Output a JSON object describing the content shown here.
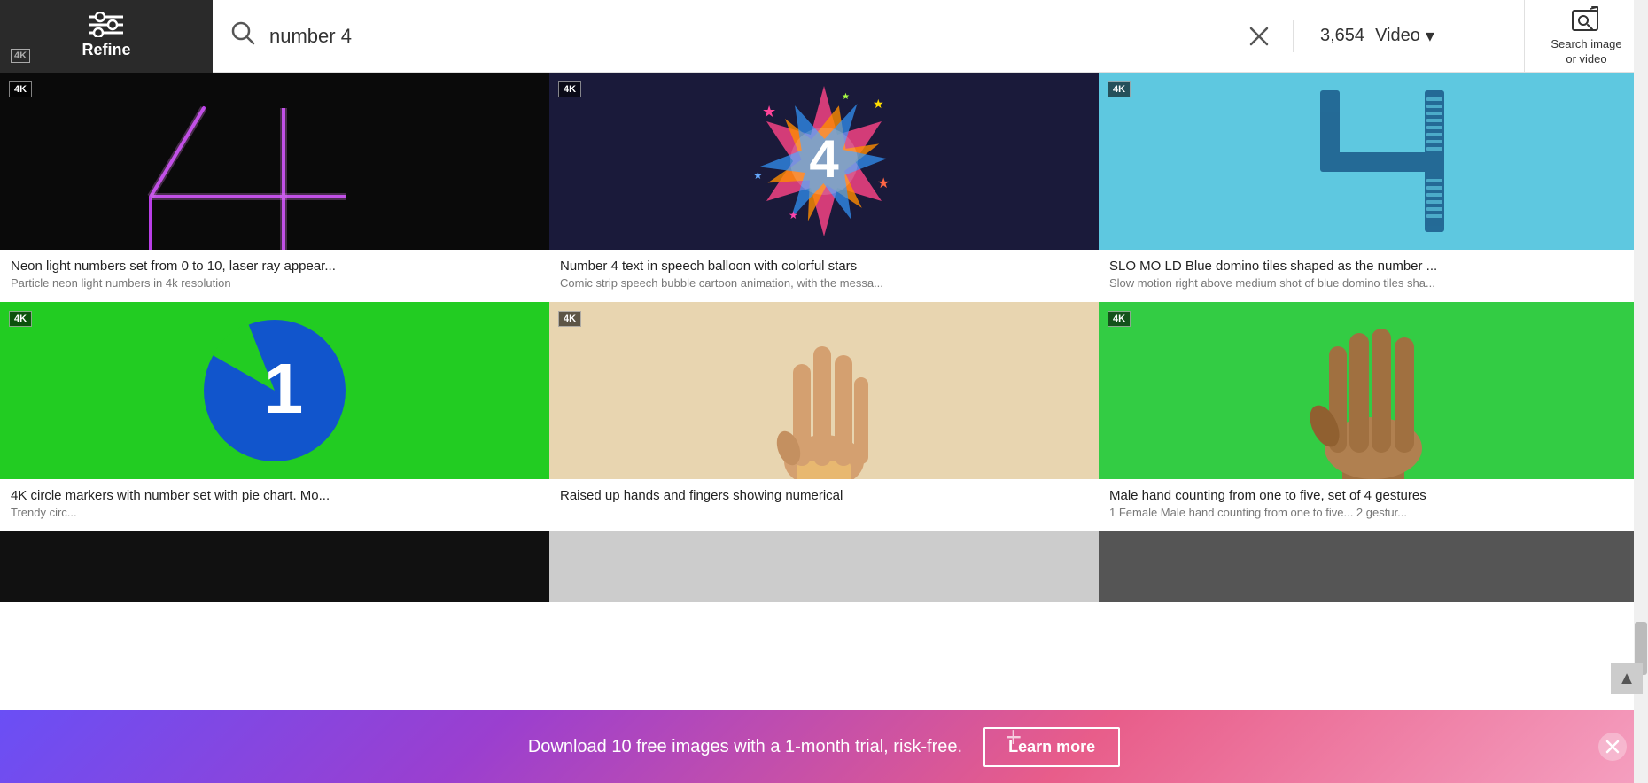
{
  "header": {
    "refine_label": "Refine",
    "refine_4k": "4K",
    "search_query": "number 4",
    "results_count": "3,654",
    "video_label": "Video",
    "search_image_label": "Search image\nor video"
  },
  "grid": {
    "items": [
      {
        "id": 1,
        "badge": "4K",
        "title": "Neon light numbers set from 0 to 10, laser ray appear...",
        "subtitle": "Particle neon light numbers in 4k resolution",
        "thumb_class": "thumb-1",
        "row": 0
      },
      {
        "id": 2,
        "badge": "4K",
        "title": "Number 4 text in speech balloon with colorful stars",
        "subtitle": "Comic strip speech bubble cartoon animation, with the messa...",
        "thumb_class": "thumb-2",
        "row": 0
      },
      {
        "id": 3,
        "badge": "4K",
        "title": "SLO MO LD Blue domino tiles shaped as the number ...",
        "subtitle": "Slow motion right above medium shot of blue domino tiles sha...",
        "thumb_class": "thumb-3",
        "row": 0
      },
      {
        "id": 4,
        "badge": "4K",
        "title": "4K circle markers with number set with pie chart. Mo...",
        "subtitle": "Trendy circ...",
        "thumb_class": "thumb-4",
        "row": 1
      },
      {
        "id": 5,
        "badge": "4K",
        "title": "Raised up hands and fingers showing numerical",
        "subtitle": "",
        "thumb_class": "thumb-5",
        "row": 1
      },
      {
        "id": 6,
        "badge": "4K",
        "title": "Male hand counting from one to five, set of 4 gestures",
        "subtitle": "1 Female Male hand counting from one to five... 2 gestur...",
        "thumb_class": "thumb-6",
        "row": 1
      }
    ]
  },
  "banner": {
    "text": "Download 10 free images with a 1-month trial, risk-free.",
    "learn_more": "Learn more",
    "plus_symbol": "+"
  },
  "icons": {
    "search": "○",
    "clear": "✕",
    "chevron_down": "▾",
    "scroll_up": "▲"
  }
}
